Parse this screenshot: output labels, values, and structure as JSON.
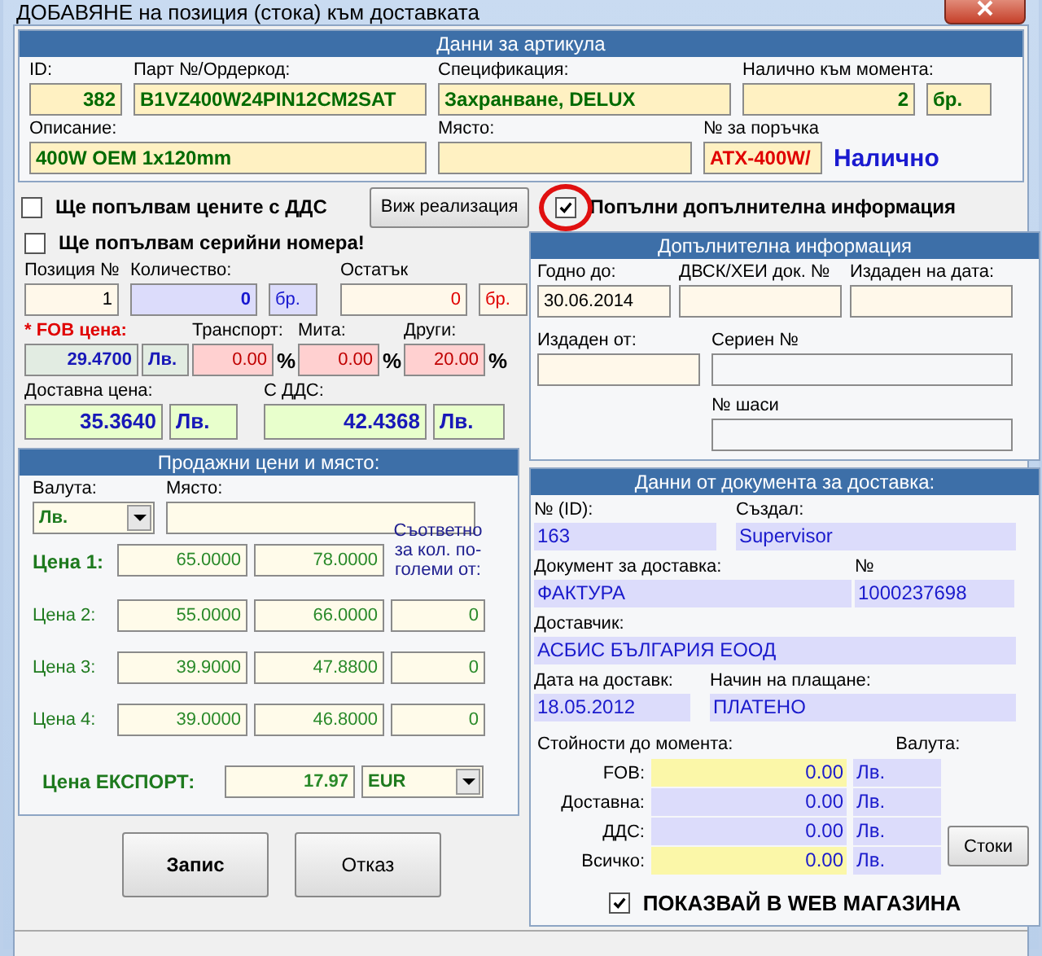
{
  "window": {
    "title": "ДОБАВЯНЕ на позиция (стока) към доставката"
  },
  "article": {
    "title": "Данни за артикула",
    "id": {
      "label": "ID:",
      "value": "382"
    },
    "part_no": {
      "label": "Парт №/Ордеркод:",
      "value": "B1VZ400W24PIN12CM2SAT"
    },
    "specification": {
      "label": "Спецификация:",
      "value": "Захранване, DELUX"
    },
    "stock": {
      "label": "Налично към момента:",
      "value": "2",
      "unit": "бр."
    },
    "description": {
      "label": "Описание:",
      "value": "400W OEM 1x120mm"
    },
    "location": {
      "label": "Място:"
    },
    "order_no": {
      "label": "№ за поръчка",
      "value": "ATX-400W/"
    },
    "availability": "Налично"
  },
  "vat_prices": {
    "label": "Ще попълвам цените с ДДС",
    "checked": false
  },
  "view_sales_button": "Виж реализация",
  "more_info": {
    "label": "Попълни допълнителна информация",
    "checked": true
  },
  "serials": {
    "label": "Ще попълвам серийни номера!",
    "checked": false
  },
  "quantities": {
    "position": {
      "label": "Позиция №",
      "value": "1"
    },
    "quantity": {
      "label": "Количество:",
      "value": "0",
      "unit": "бр."
    },
    "remainder": {
      "label": "Остатък",
      "value": "0",
      "unit": "бр."
    }
  },
  "costs": {
    "fob": {
      "label": "* FOB цена:",
      "value": "29.4700",
      "unit": "Лв."
    },
    "surcharges": [
      {
        "label": "Транспорт:",
        "value": "0.00",
        "unit": "%"
      },
      {
        "label": "Мита:",
        "value": "0.00",
        "unit": "%"
      },
      {
        "label": "Други:",
        "value": "20.00",
        "unit": "%"
      }
    ],
    "delivery_price": {
      "label": "Доставна цена:",
      "value": "35.3640",
      "unit": "Лв."
    },
    "with_vat": {
      "label": "С ДДС:",
      "value": "42.4368",
      "unit": "Лв."
    }
  },
  "sales": {
    "title": "Продажни цени и място:",
    "currency": {
      "label": "Валута:",
      "value": "Лв."
    },
    "location": {
      "label": "Място:"
    },
    "qty_note": "Съответно за кол. по-големи от:",
    "prices": [
      {
        "label": "Цена 1:",
        "net": "65.0000",
        "gross": "78.0000",
        "emphasized": true
      },
      {
        "label": "Цена 2:",
        "net": "55.0000",
        "gross": "66.0000",
        "min_qty": "0",
        "emphasized": false
      },
      {
        "label": "Цена 3:",
        "net": "39.9000",
        "gross": "47.8800",
        "min_qty": "0",
        "emphasized": false
      },
      {
        "label": "Цена 4:",
        "net": "39.0000",
        "gross": "46.8000",
        "min_qty": "0",
        "emphasized": false
      }
    ],
    "export": {
      "label": "Цена ЕКСПОРТ:",
      "value": "17.97",
      "currency": "EUR"
    }
  },
  "buttons": [
    "Запис",
    "Отказ"
  ],
  "extra": {
    "title": "Допълнителна информация",
    "fields": [
      {
        "label": "Годно до:",
        "value": "30.06.2014"
      },
      {
        "label": "ДВСК/ХЕИ док. №"
      },
      {
        "label": "Издаден на дата:"
      },
      {
        "label": "Издаден от:"
      },
      {
        "label": "Сериен №"
      },
      {
        "label": "№ шаси"
      }
    ]
  },
  "delivery": {
    "title": "Данни от документа за доставка:",
    "id": {
      "label": "№ (ID):",
      "value": "163"
    },
    "created_by": {
      "label": "Създал:",
      "value": "Supervisor"
    },
    "document": {
      "label": "Документ за доставка:",
      "value": "ФАКТУРА"
    },
    "number": {
      "label": "№",
      "value": "1000237698"
    },
    "supplier": {
      "label": "Доставчик:",
      "value": "АСБИС БЪЛГАРИЯ ЕООД"
    },
    "date": {
      "label": "Дата на доставк:",
      "value": "18.05.2012"
    },
    "payment": {
      "label": "Начин на плащане:",
      "value": "ПЛАТЕНО"
    },
    "totals_label": "Стойности до момента:",
    "currency_label": "Валута:",
    "totals": [
      {
        "label": "FOB:",
        "value": "0.00",
        "currency": "Лв.",
        "kind": "highlight"
      },
      {
        "label": "Доставна:",
        "value": "0.00",
        "currency": "Лв.",
        "kind": "plain"
      },
      {
        "label": "ДДС:",
        "value": "0.00",
        "currency": "Лв.",
        "kind": "plain"
      },
      {
        "label": "Всичко:",
        "value": "0.00",
        "currency": "Лв.",
        "kind": "total"
      }
    ],
    "goods_button": "Стоки",
    "web_shop": {
      "label": "ПОКАЗВАЙ В WEB МАГАЗИНА",
      "checked": true
    }
  }
}
